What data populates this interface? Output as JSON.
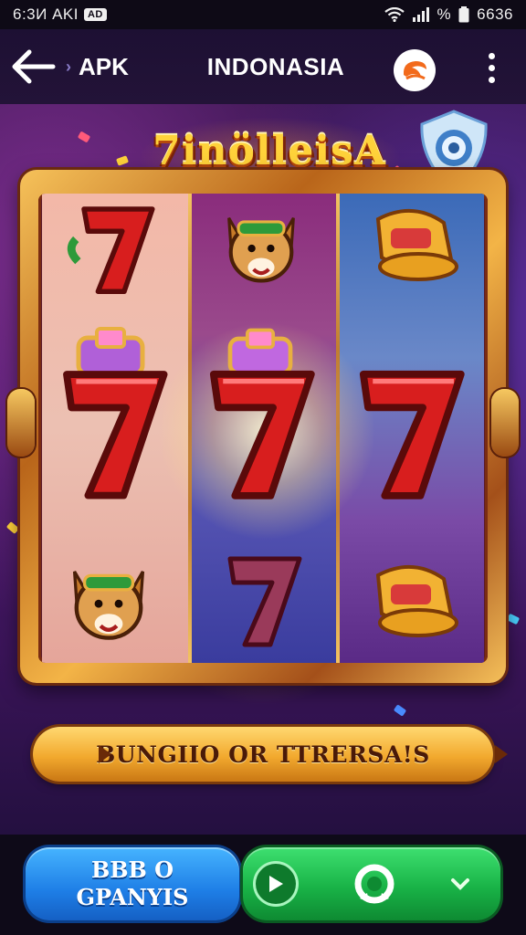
{
  "status_bar": {
    "time": "6:3И AKI",
    "badge": "AD",
    "battery_label": "%",
    "right_time": "6636"
  },
  "app_bar": {
    "back_icon": "arrow-left-icon",
    "apk_label": "APK",
    "title": "INDONASIA",
    "brand_icon": "brand-logo-icon",
    "menu_icon": "more-vertical-icon"
  },
  "game": {
    "title": "7inölleisA",
    "reels": [
      [
        "7",
        "7",
        "dog"
      ],
      [
        "dog",
        "7",
        "7"
      ],
      [
        "bell",
        "7",
        "bell"
      ]
    ],
    "win_line": [
      "7",
      "7",
      "7"
    ],
    "collect_label": "BUNGIIO OR TTRERSA!S"
  },
  "bottom": {
    "bonus_line1": "BBB O",
    "bonus_line2": "GPANYIS",
    "play_icon": "play-icon",
    "spin_icon": "spin-refresh-icon",
    "chevron_icon": "chevron-down-icon"
  },
  "colors": {
    "accent_gold": "#f2a92e",
    "seven_red": "#d81e1e",
    "bonus_blue": "#1e7ee6",
    "spin_green": "#19b347"
  }
}
